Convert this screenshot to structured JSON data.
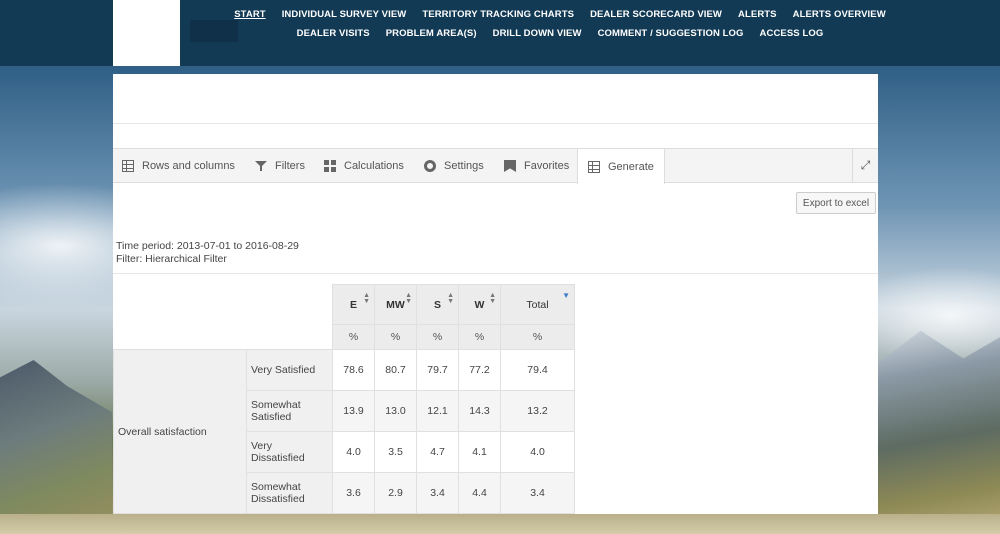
{
  "nav": {
    "row1": [
      "START",
      "INDIVIDUAL SURVEY VIEW",
      "TERRITORY TRACKING CHARTS",
      "DEALER SCORECARD VIEW",
      "ALERTS",
      "ALERTS OVERVIEW"
    ],
    "row2": [
      "DEALER VISITS",
      "PROBLEM AREA(S)",
      "DRILL DOWN VIEW",
      "COMMENT / SUGGESTION LOG",
      "ACCESS LOG"
    ],
    "active": "START"
  },
  "tabs": [
    {
      "label": "Rows and columns",
      "icon": "grid-icon"
    },
    {
      "label": "Filters",
      "icon": "filter-icon"
    },
    {
      "label": "Calculations",
      "icon": "calculator-icon"
    },
    {
      "label": "Settings",
      "icon": "gear-icon"
    },
    {
      "label": "Favorites",
      "icon": "bookmark-icon"
    },
    {
      "label": "Generate",
      "icon": "table-icon"
    }
  ],
  "active_tab": "Generate",
  "expand_icon": "expand-icon",
  "export_label": "Export to excel",
  "meta": {
    "time_period": "Time period: 2013-07-01 to 2016-08-29",
    "filter": "Filter: Hierarchical Filter"
  },
  "table": {
    "columns": [
      "E",
      "MW",
      "S",
      "W",
      "Total"
    ],
    "unit_row": [
      "%",
      "%",
      "%",
      "%",
      "%"
    ],
    "group_label": "Overall satisfaction",
    "rows": [
      {
        "label": "Very Satisfied",
        "values": [
          "78.6",
          "80.7",
          "79.7",
          "77.2",
          "79.4"
        ]
      },
      {
        "label": "Somewhat Satisfied",
        "values": [
          "13.9",
          "13.0",
          "12.1",
          "14.3",
          "13.2"
        ]
      },
      {
        "label": "Very Dissatisfied",
        "values": [
          "4.0",
          "3.5",
          "4.7",
          "4.1",
          "4.0"
        ]
      },
      {
        "label": "Somewhat Dissatisfied",
        "values": [
          "3.6",
          "2.9",
          "3.4",
          "4.4",
          "3.4"
        ]
      }
    ]
  }
}
